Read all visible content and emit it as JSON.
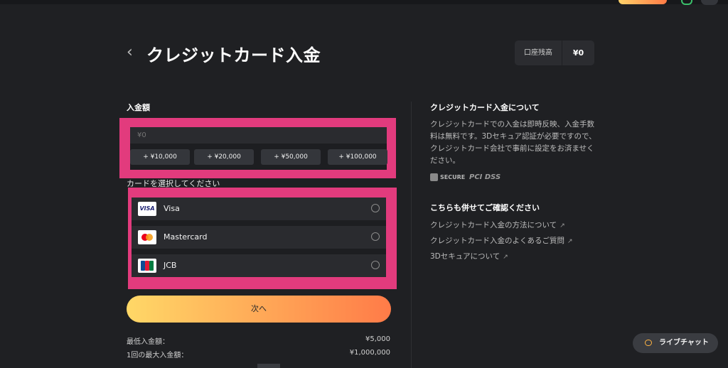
{
  "header": {
    "back_icon": "chevron-left-icon",
    "title": "クレジットカード入金",
    "balance_label": "口座残高",
    "balance_value": "¥0"
  },
  "amount": {
    "label": "入金額",
    "placeholder": "¥0",
    "quick_buttons": [
      "+ ¥10,000",
      "+ ¥20,000",
      "+ ¥50,000",
      "+ ¥100,000"
    ]
  },
  "cards": {
    "label": "カードを選択してください",
    "items": [
      {
        "name": "Visa",
        "logo": "VISA"
      },
      {
        "name": "Mastercard",
        "logo": "mastercard-logo"
      },
      {
        "name": "JCB",
        "logo": "jcb-logo"
      }
    ]
  },
  "next_button": "次へ",
  "limits": [
    {
      "label": "最低入金額：",
      "value": "¥5,000"
    },
    {
      "label": "1回の最大入金額：",
      "value": "¥1,000,000"
    }
  ],
  "info": {
    "title": "クレジットカード入金について",
    "body": "クレジットカードでの入金は即時反映、入金手数料は無料です。3Dセキュア認証が必要ですので、クレジットカード会社で事前に設定をお済ませください。",
    "badge_secure": "SECURE",
    "badge_pci": "PCI DSS"
  },
  "also": {
    "title": "こちらも併せてご確認ください",
    "links": [
      "クレジットカード入金の方法について",
      "クレジットカード入金のよくあるご質問",
      "3Dセキュアについて"
    ]
  },
  "chat": {
    "label": "ライブチャット"
  },
  "colors": {
    "background": "#1f2023",
    "highlight": "#e23b7d",
    "accent_start": "#ffd867",
    "accent_end": "#ff7b48"
  }
}
